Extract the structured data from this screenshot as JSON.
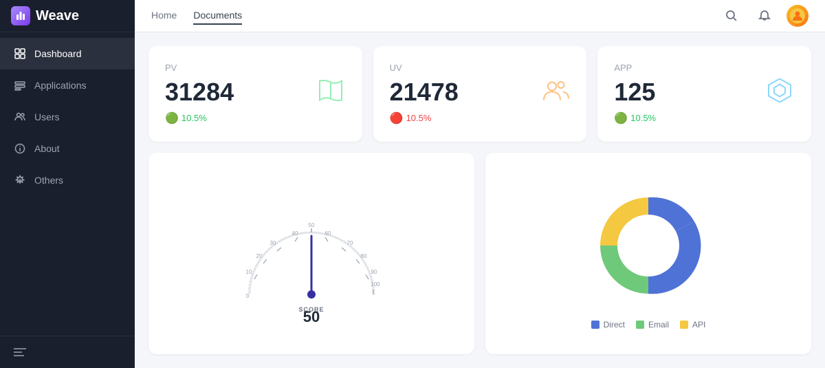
{
  "app": {
    "name": "Weave"
  },
  "sidebar": {
    "items": [
      {
        "id": "dashboard",
        "label": "Dashboard",
        "active": true
      },
      {
        "id": "applications",
        "label": "Applications",
        "active": false
      },
      {
        "id": "users",
        "label": "Users",
        "active": false
      },
      {
        "id": "about",
        "label": "About",
        "active": false
      },
      {
        "id": "others",
        "label": "Others",
        "active": false
      }
    ]
  },
  "header": {
    "nav": [
      {
        "id": "home",
        "label": "Home",
        "active": false
      },
      {
        "id": "documents",
        "label": "Documents",
        "active": true
      }
    ]
  },
  "stats": [
    {
      "id": "pv",
      "label": "PV",
      "value": "31284",
      "change": "10.5%",
      "direction": "up",
      "icon_color": "#86efac",
      "icon": "book"
    },
    {
      "id": "uv",
      "label": "UV",
      "value": "21478",
      "change": "10.5%",
      "direction": "down",
      "icon_color": "#fdba74",
      "icon": "users"
    },
    {
      "id": "app",
      "label": "APP",
      "value": "125",
      "change": "10.5%",
      "direction": "up",
      "icon_color": "#7dd3fc",
      "icon": "hex"
    }
  ],
  "gauge": {
    "score_label": "SCORE",
    "score_value": "50",
    "ticks": [
      "10",
      "20",
      "30",
      "40",
      "50",
      "60",
      "70",
      "80",
      "90",
      "100"
    ]
  },
  "donut": {
    "segments": [
      {
        "label": "Direct",
        "value": 45,
        "color": "#4f72d6"
      },
      {
        "label": "Email",
        "value": 30,
        "color": "#6ec97a"
      },
      {
        "label": "API",
        "value": 25,
        "color": "#f5c842"
      }
    ]
  }
}
